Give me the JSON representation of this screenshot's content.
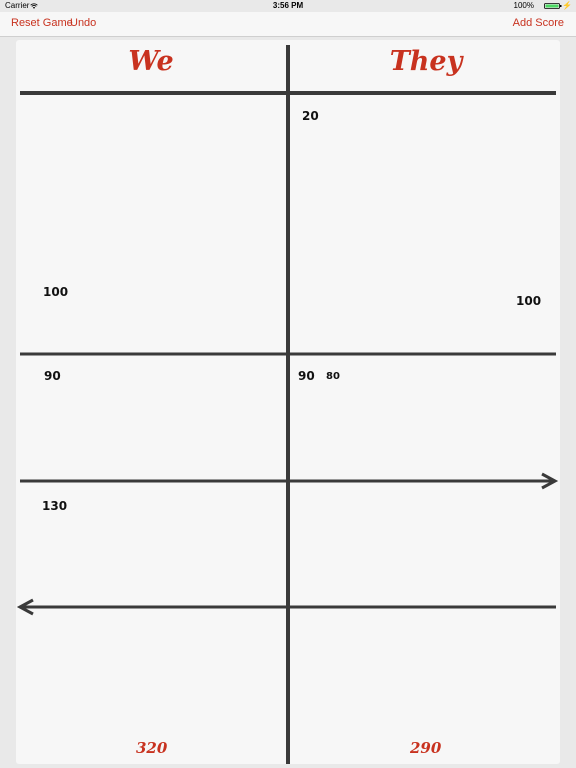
{
  "status": {
    "carrier": "Carrier",
    "time": "3:56 PM",
    "battery": "100%"
  },
  "toolbar": {
    "reset_label": "Reset Game",
    "undo_label": "Undo",
    "add_label": "Add Score"
  },
  "columns": {
    "we": "We",
    "they": "They"
  },
  "entries": {
    "we_100": "100",
    "we_90": "90",
    "we_130": "130",
    "they_20": "20",
    "they_100": "100",
    "they_90": "90",
    "they_80": "80"
  },
  "totals": {
    "we": "320",
    "they": "290"
  },
  "colors": {
    "accent": "#c8321f",
    "line": "#3a3a3a",
    "pad": "#f7f7f7"
  }
}
